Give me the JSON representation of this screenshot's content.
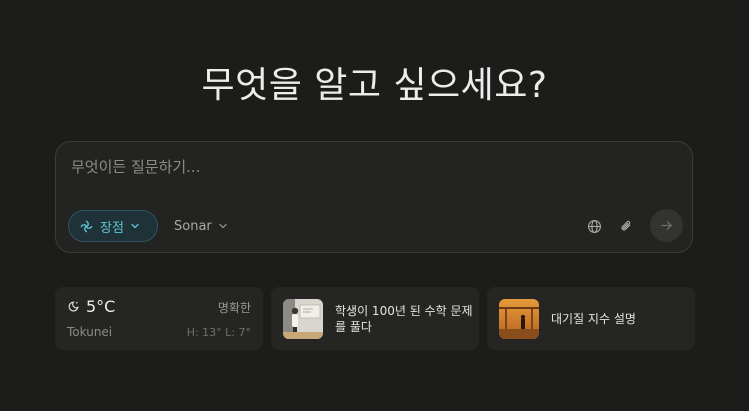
{
  "headline": "무엇을 알고 싶으세요?",
  "composer": {
    "placeholder": "무엇이든 질문하기...",
    "mode_label": "장점",
    "model_label": "Sonar",
    "icons": [
      "globe-icon",
      "paperclip-icon",
      "arrow-right-icon"
    ]
  },
  "weather": {
    "temperature": "5°C",
    "condition": "명확한",
    "location": "Tokunei",
    "hilo": "H: 13° L: 7°",
    "icon": "moon-cloud-icon"
  },
  "news": [
    {
      "title": "학생이 100년 된 수학 문제를 풀다"
    },
    {
      "title": "대기질 지수 설명"
    }
  ],
  "colors": {
    "background": "#1c1c1b",
    "accent": "#5fc4d4"
  }
}
